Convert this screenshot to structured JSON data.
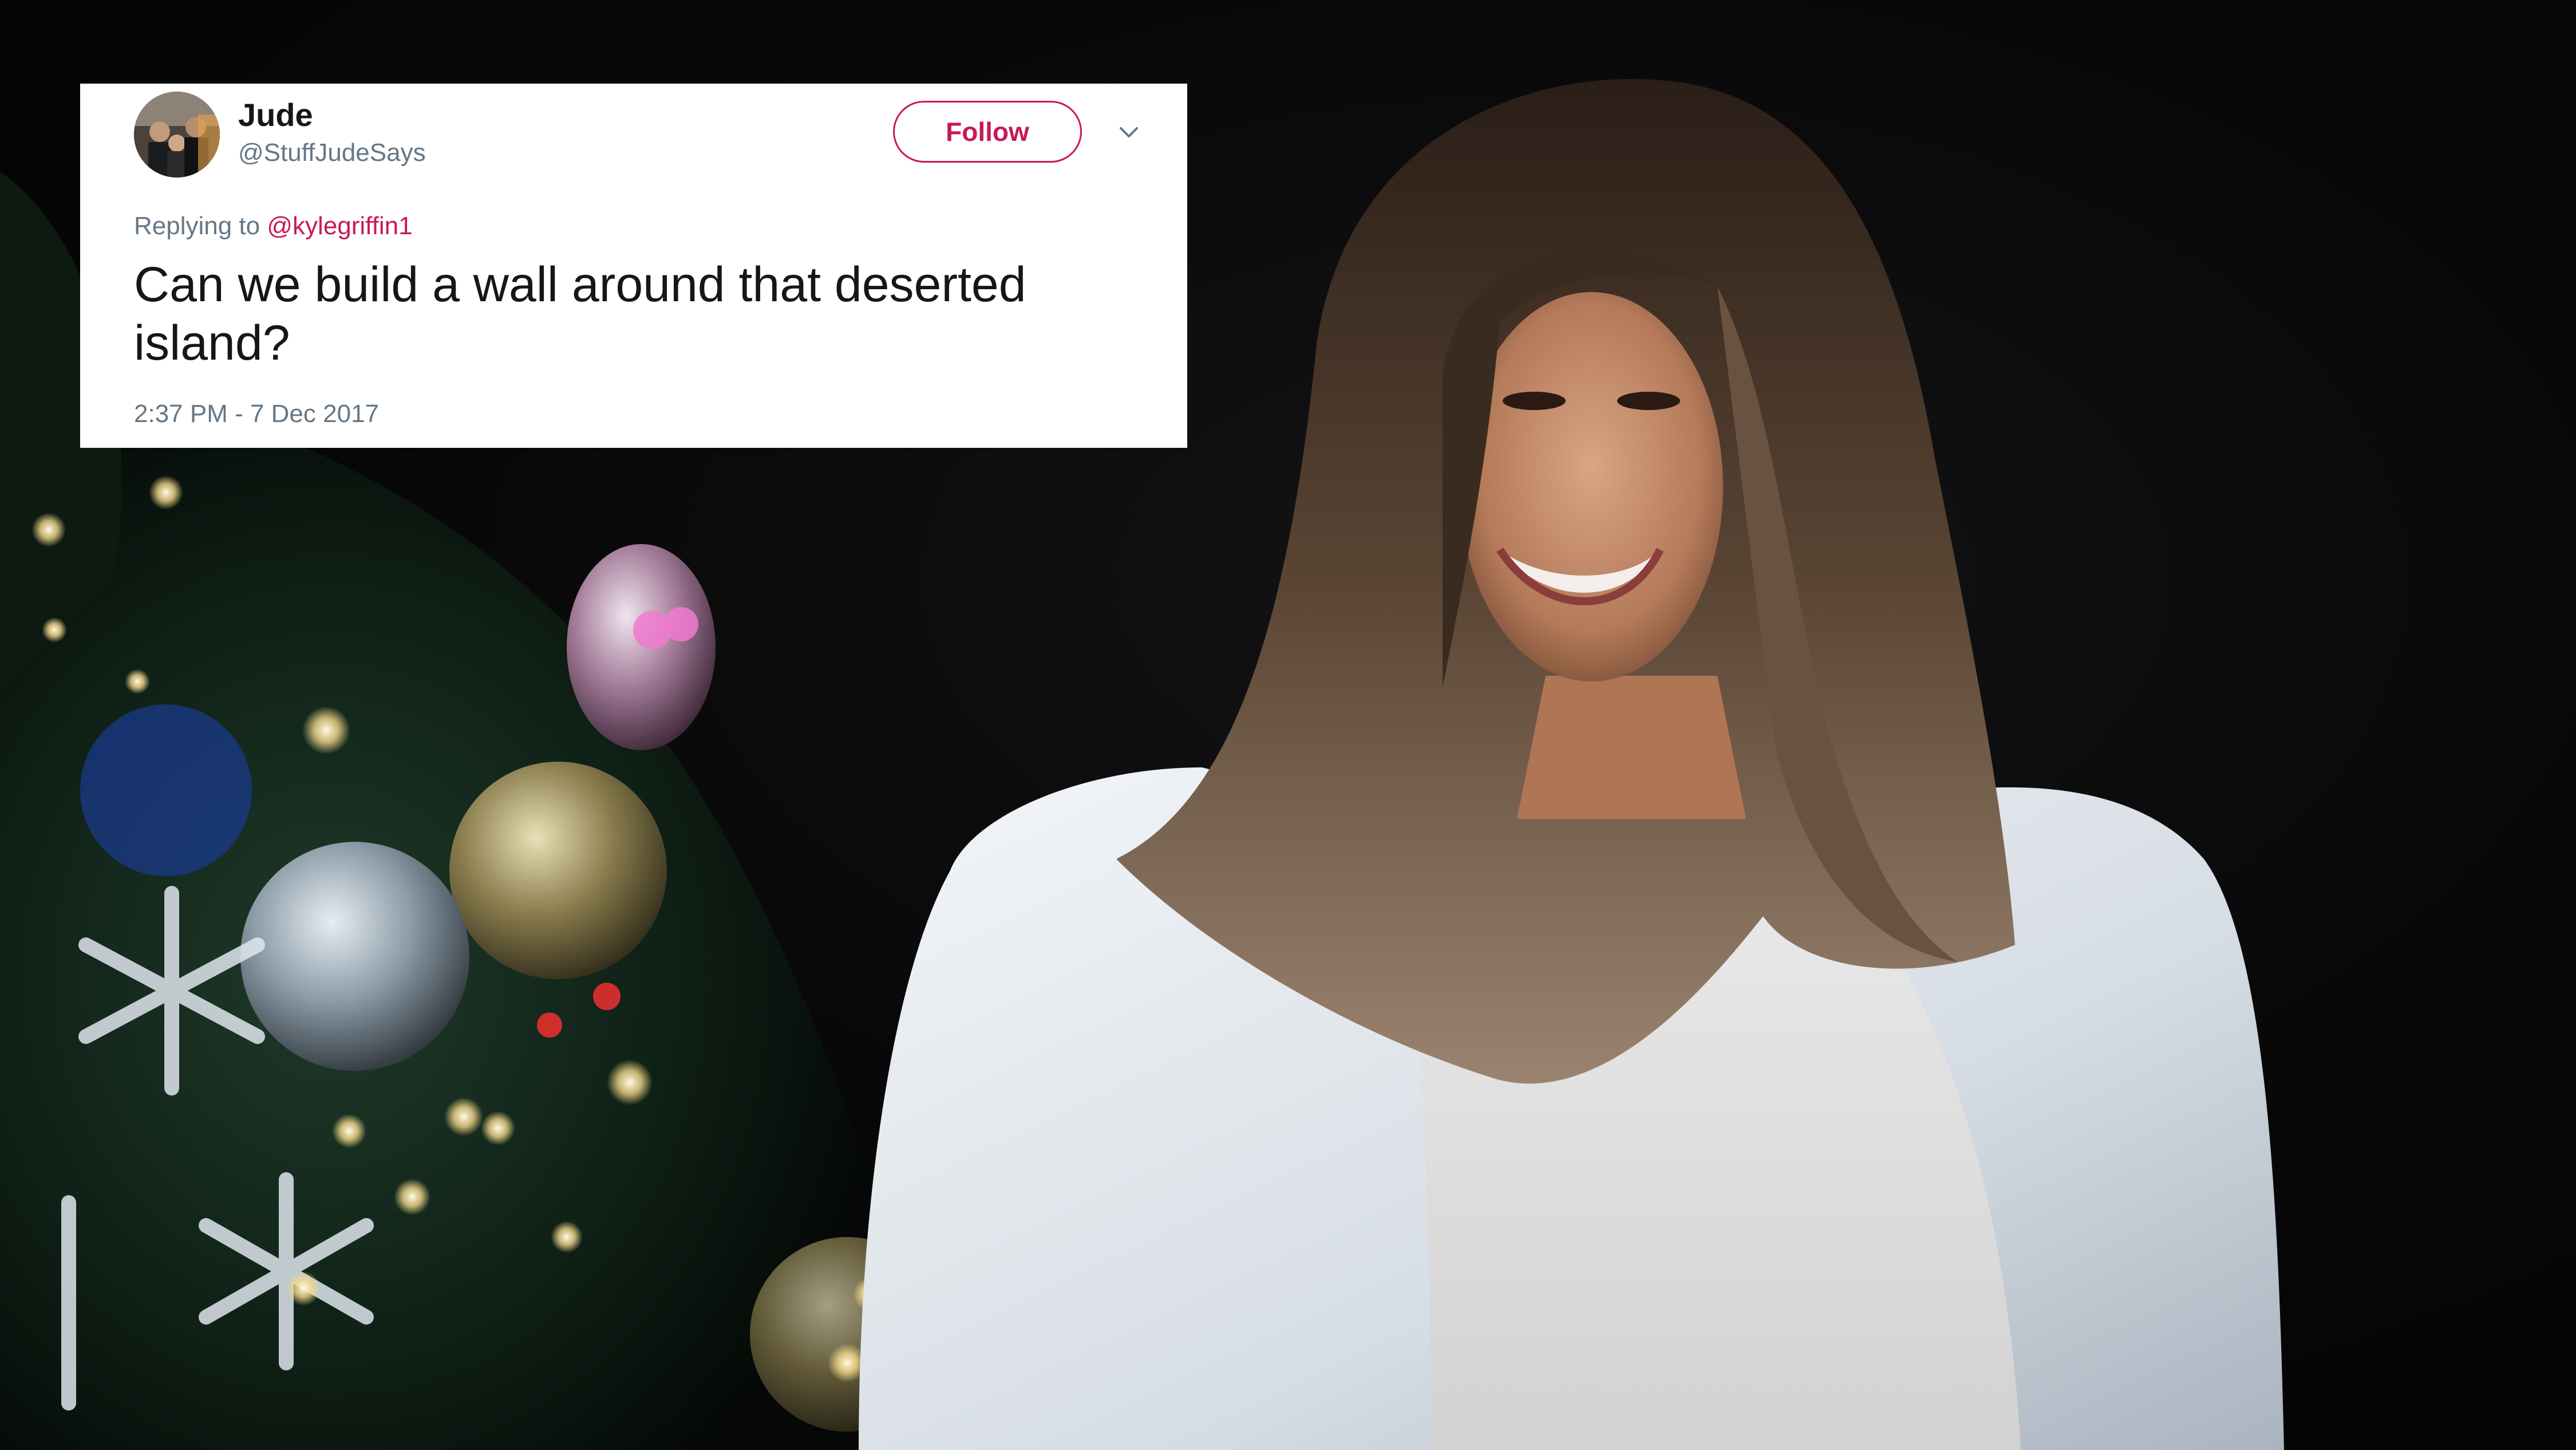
{
  "tweet": {
    "display_name": "Jude",
    "handle": "@StuffJudeSays",
    "follow_label": "Follow",
    "replying_prefix": "Replying to",
    "replying_to": "@kylegriffin1",
    "text": "Can we build a wall around that deserted island?",
    "timestamp": "2:37 PM - 7 Dec 2017",
    "avatar_icon": "profile-photo",
    "menu_icon": "chevron-down-icon"
  },
  "colors": {
    "accent": "#c8185a",
    "text_primary": "#14171a",
    "text_secondary": "#657786",
    "card_bg": "#ffffff",
    "photo_bg": "#050505"
  }
}
